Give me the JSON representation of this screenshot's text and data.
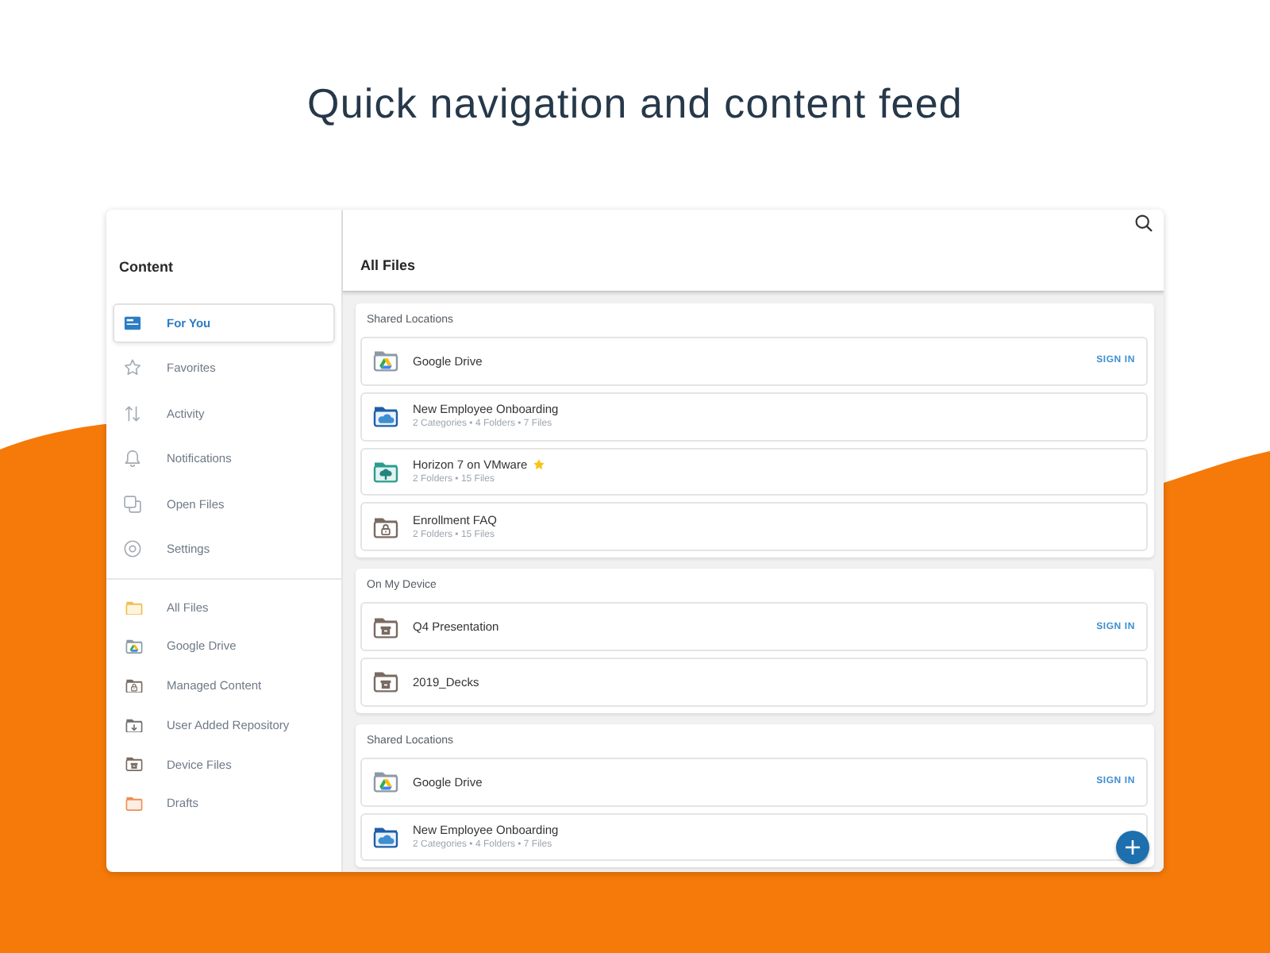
{
  "headline": "Quick navigation and content feed",
  "sidebar": {
    "title": "Content",
    "nav_items": [
      {
        "label": "For You",
        "selected": true
      },
      {
        "label": "Favorites",
        "selected": false
      },
      {
        "label": "Activity",
        "selected": false
      },
      {
        "label": "Notifications",
        "selected": false
      },
      {
        "label": "Open Files",
        "selected": false
      },
      {
        "label": "Settings",
        "selected": false
      }
    ],
    "locations": [
      {
        "label": "All Files",
        "kind": "plain",
        "selected": false
      },
      {
        "label": "Google Drive",
        "kind": "drive",
        "selected": false
      },
      {
        "label": "Managed Content",
        "kind": "lock",
        "selected": false
      },
      {
        "label": "User Added Repository",
        "kind": "arrow",
        "selected": false
      },
      {
        "label": "Device Files",
        "kind": "box",
        "selected": false
      },
      {
        "label": "Drafts",
        "kind": "draft",
        "selected": false
      }
    ]
  },
  "main": {
    "title": "All Files",
    "sections": [
      {
        "heading": "Shared Locations",
        "rows": [
          {
            "kind": "drive",
            "title": "Google Drive",
            "starred": false,
            "action": "SIGN IN"
          },
          {
            "kind": "cloud",
            "title": "New Employee Onboarding",
            "details": "2 Categories • 4 Folders • 7 Files",
            "starred": false
          },
          {
            "kind": "tree",
            "title": "Horizon 7 on VMware",
            "details": "2 Folders • 15 Files",
            "starred": true
          },
          {
            "kind": "lock",
            "title": "Enrollment FAQ",
            "details": "2 Folders • 15 Files",
            "starred": false
          }
        ]
      },
      {
        "heading": "On My Device",
        "rows": [
          {
            "kind": "box",
            "title": "Q4 Presentation",
            "starred": false,
            "action": "SIGN IN"
          },
          {
            "kind": "box",
            "title": "2019_Decks",
            "starred": false
          }
        ]
      },
      {
        "heading": "Shared Locations",
        "rows": [
          {
            "kind": "drive",
            "title": "Google Drive",
            "starred": false,
            "action": "SIGN IN"
          },
          {
            "kind": "cloud",
            "title": "New Employee Onboarding",
            "details": "2 Categories • 4 Folders • 7 Files",
            "starred": false
          }
        ]
      }
    ]
  }
}
